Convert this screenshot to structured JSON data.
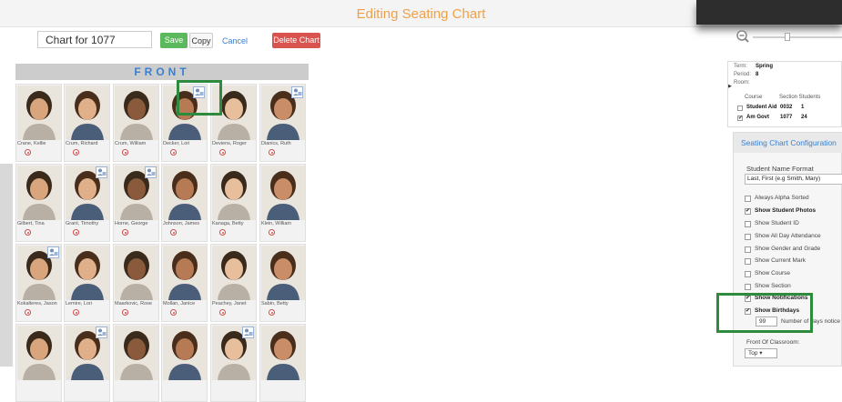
{
  "header": {
    "title": "Editing Seating Chart"
  },
  "toolbar": {
    "chart_name": "Chart for 1077",
    "save_label": "Save",
    "copy_label": "Copy",
    "cancel_label": "Cancel",
    "delete_label": "Delete Chart"
  },
  "chart": {
    "front_label": "FRONT",
    "students": [
      {
        "name": "Crane, Kellie"
      },
      {
        "name": "Crum, Richard"
      },
      {
        "name": "Crum, William"
      },
      {
        "name": "Decker, Lori"
      },
      {
        "name": "Deviens, Roger"
      },
      {
        "name": "Dianics, Ruth"
      },
      {
        "name": "Gilbert, Tina"
      },
      {
        "name": "Grant, Timothy"
      },
      {
        "name": "Horne, George"
      },
      {
        "name": "Johnson, James"
      },
      {
        "name": "Kanaga, Betty"
      },
      {
        "name": "Klein, William"
      },
      {
        "name": "Kokalteres, Jason"
      },
      {
        "name": "Lemire, Lori"
      },
      {
        "name": "Maarkovic, Rose"
      },
      {
        "name": "Mollan, Janice"
      },
      {
        "name": "Peachey, Janet"
      },
      {
        "name": "Sabin, Betty"
      },
      {
        "name": ""
      },
      {
        "name": ""
      },
      {
        "name": ""
      },
      {
        "name": ""
      },
      {
        "name": ""
      },
      {
        "name": ""
      }
    ]
  },
  "info": {
    "term_label": "Term:",
    "term_value": "Spring",
    "period_label": "Period:",
    "period_value": "8",
    "room_label": "Room:",
    "col_course": "Course",
    "col_section": "Section Students",
    "courses": [
      {
        "name": "Student Aid",
        "section": "0032",
        "students": "1",
        "checked": false
      },
      {
        "name": "Am Govt",
        "section": "1077",
        "students": "24",
        "checked": true
      }
    ]
  },
  "config": {
    "title": "Seating Chart Configuration",
    "name_format_label": "Student Name Format",
    "name_format_value": "Last, First (e.g Smith, Mary)",
    "options": [
      {
        "label": "Always Alpha Sorted",
        "checked": false
      },
      {
        "label": "Show Student Photos",
        "checked": true
      },
      {
        "label": "Show Student ID",
        "checked": false
      },
      {
        "label": "Show All Day Attendance",
        "checked": false
      },
      {
        "label": "Show Gender and Grade",
        "checked": false
      },
      {
        "label": "Show Current Mark",
        "checked": false
      },
      {
        "label": "Show Course",
        "checked": false
      },
      {
        "label": "Show Section",
        "checked": false
      },
      {
        "label": "Show Notifications",
        "checked": true
      },
      {
        "label": "Show Birthdays",
        "checked": true
      }
    ],
    "days_value": "99",
    "days_label": "Number of days notice",
    "front_label": "Front Of Classroom:",
    "front_value": "Top"
  },
  "colors": {
    "accent": "#f0a047",
    "link": "#3a7fd0",
    "save": "#5cb85c",
    "delete": "#d9534f",
    "highlight": "#2e8b3d"
  }
}
